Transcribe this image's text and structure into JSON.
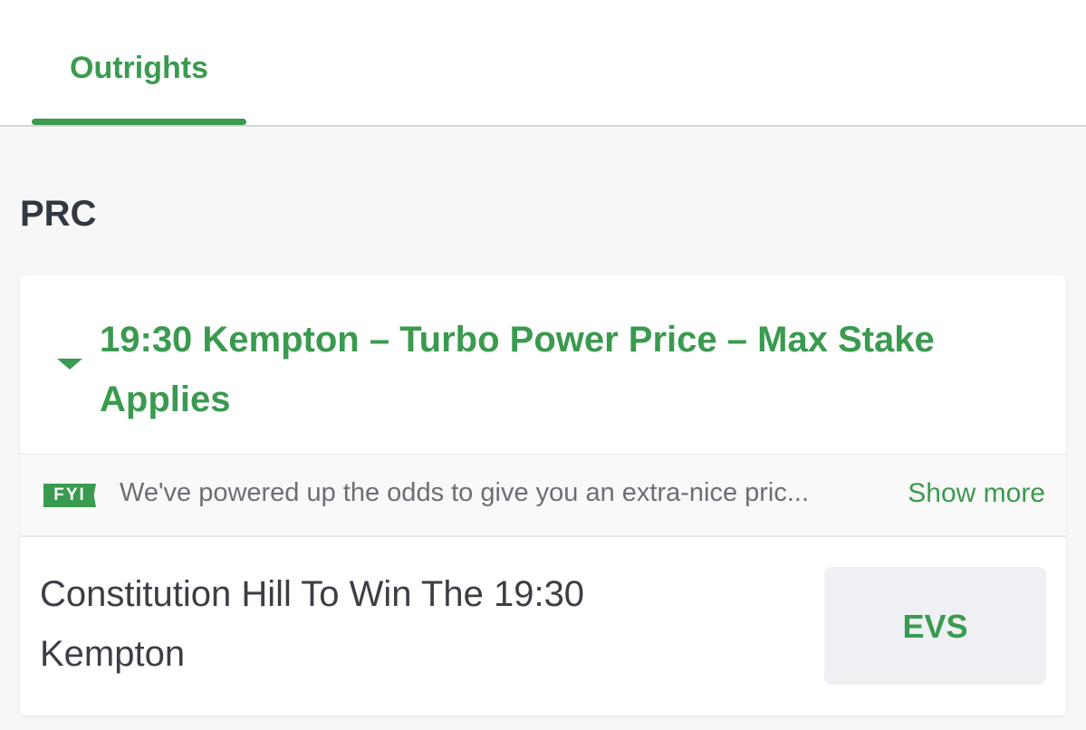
{
  "tabs": [
    {
      "label": "Outrights",
      "active": true
    }
  ],
  "section": {
    "title": "PRC"
  },
  "market": {
    "title": "19:30 Kempton – Turbo Power Price – Max Stake Applies",
    "expanded": true,
    "fyi": {
      "badge": "FYI",
      "text": "We've powered up the odds to give you an extra-nice pric...",
      "show_more_label": "Show more"
    },
    "selections": [
      {
        "name": "Constitution Hill To Win The 19:30 Kempton",
        "price": "EVS"
      }
    ]
  },
  "colors": {
    "accent": "#3a9a4f",
    "text_dark": "#333840",
    "text_muted": "#6b6f75",
    "price_bg": "#eef0f3"
  },
  "icons": {
    "collapse": "caret-down-icon"
  }
}
